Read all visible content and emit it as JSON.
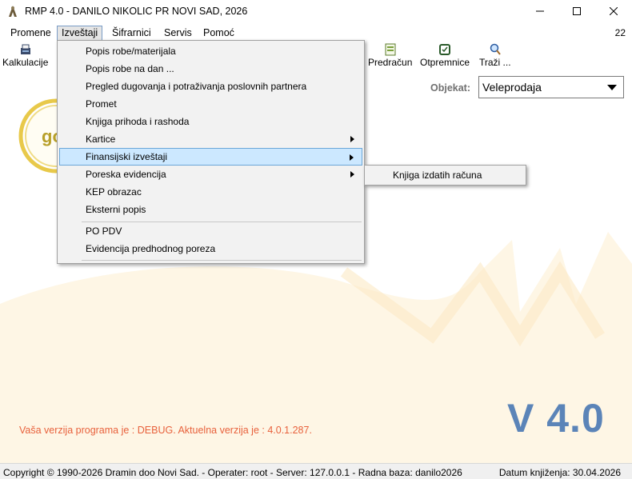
{
  "window": {
    "title": "RMP 4.0 - DANILO NIKOLIC PR NOVI SAD, 2026",
    "controls": {
      "minimize": "minimize-icon",
      "maximize": "maximize-icon",
      "close": "close-icon"
    }
  },
  "menubar": {
    "items": [
      {
        "label": "Promene"
      },
      {
        "label": "Izveštaji"
      },
      {
        "label": "Šifrarnici"
      },
      {
        "label": "Servis"
      },
      {
        "label": "Pomoć"
      }
    ],
    "counter": "22"
  },
  "toolbar": {
    "items": [
      {
        "label": "Kalkulacije",
        "icon": "calculation-icon"
      },
      {
        "label": "Predračun",
        "icon": "invoice-icon"
      },
      {
        "label": "Otpremnice",
        "icon": "dispatch-note-icon"
      },
      {
        "label": "Traži ...",
        "icon": "search-icon"
      }
    ]
  },
  "objekat": {
    "label": "Objekat:",
    "value": "Veleprodaja"
  },
  "dropdown": {
    "items": [
      {
        "label": "Popis robe/materijala"
      },
      {
        "label": "Popis robe na dan ..."
      },
      {
        "label": "Pregled dugovanja i potraživanja poslovnih partnera"
      },
      {
        "label": "Promet"
      },
      {
        "label": "Knjiga prihoda i rashoda"
      },
      {
        "label": "Kartice"
      },
      {
        "label": "Finansijski izveštaji"
      },
      {
        "label": "Poreska evidencija"
      },
      {
        "label": "KEP obrazac"
      },
      {
        "label": "Eksterni popis"
      },
      {
        "label": "PO PDV"
      },
      {
        "label": "Evidencija predhodnog poreza"
      }
    ],
    "submenu": {
      "items": [
        {
          "label": "Knjiga izdatih računa"
        }
      ]
    }
  },
  "info": {
    "version_warning": "Vaša verzija programa je : DEBUG. Aktuelna verzija je : 4.0.1.287.",
    "version_big": "V 4.0",
    "logo_text": "go"
  },
  "status": {
    "left": "Copyright © 1990-2026 Dramin doo Novi Sad. - Operater: root - Server: 127.0.0.1 - Radna baza: danilo2026",
    "right": "Datum knjiženja: 30.04.2026"
  },
  "colors": {
    "menu_highlight": "#cce8ff",
    "version_warning": "#e8613c",
    "version_big": "#5b84b8",
    "watermark": "#fdf3dc"
  }
}
